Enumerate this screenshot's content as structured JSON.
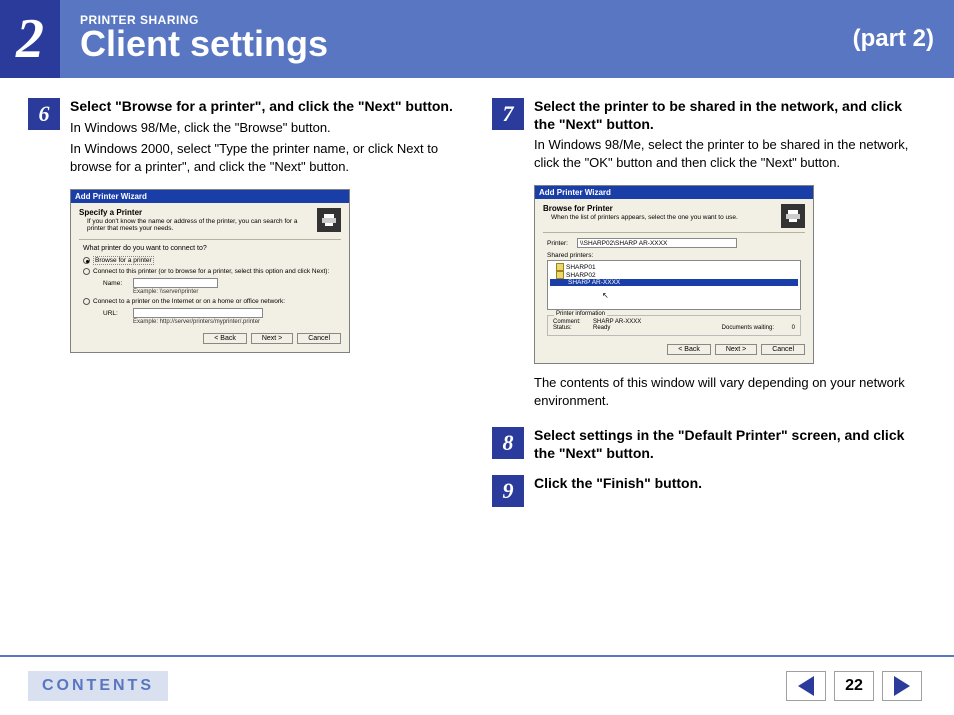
{
  "header": {
    "chapter_number": "2",
    "label": "PRINTER SHARING",
    "title": "Client settings",
    "part": "(part 2)"
  },
  "steps": {
    "s6": {
      "num": "6",
      "title": "Select \"Browse for a printer\", and click the \"Next\" button.",
      "text1": "In Windows 98/Me, click the \"Browse\" button.",
      "text2": "In Windows 2000, select \"Type the printer name, or click Next to browse for a printer\", and click the \"Next\" button."
    },
    "s7": {
      "num": "7",
      "title": "Select the printer to be shared in the network, and click the \"Next\" button.",
      "text": "In Windows 98/Me, select the printer to be shared in the network, click the \"OK\" button and then click the \"Next\" button.",
      "note_after": "The contents of this window will vary depending on your network environment."
    },
    "s8": {
      "num": "8",
      "title": "Select settings in the \"Default Printer\" screen, and click the \"Next\" button."
    },
    "s9": {
      "num": "9",
      "title": "Click the \"Finish\" button."
    }
  },
  "dialog6": {
    "title": "Add Printer Wizard",
    "section": "Specify a Printer",
    "section_sub": "If you don't know the name or address of the printer, you can search for a printer that meets your needs.",
    "prompt": "What printer do you want to connect to?",
    "r1": "Browse for a printer",
    "r2": "Connect to this printer (or to browse for a printer, select this option and click Next):",
    "name_label": "Name:",
    "example1": "Example: \\\\server\\printer",
    "r3": "Connect to a printer on the Internet or on a home or office network:",
    "url_label": "URL:",
    "example2": "Example: http://server/printers/myprinter/.printer",
    "back": "< Back",
    "next": "Next >",
    "cancel": "Cancel"
  },
  "dialog7": {
    "title": "Add Printer Wizard",
    "section": "Browse for Printer",
    "section_sub": "When the list of printers appears, select the one you want to use.",
    "printer_label": "Printer:",
    "printer_value": "\\\\SHARP02\\SHARP AR-XXXX",
    "shared_label": "Shared printers:",
    "tree1": "SHARP01",
    "tree2": "SHARP02",
    "tree3": "SHARP AR-XXXX",
    "info_title": "Printer information",
    "comment_label": "Comment:",
    "comment_value": "SHARP AR-XXXX",
    "status_label": "Status:",
    "status_value": "Ready",
    "docs_label": "Documents waiting:",
    "docs_value": "0",
    "back": "< Back",
    "next": "Next >",
    "cancel": "Cancel"
  },
  "footer": {
    "contents": "CONTENTS",
    "page": "22"
  }
}
